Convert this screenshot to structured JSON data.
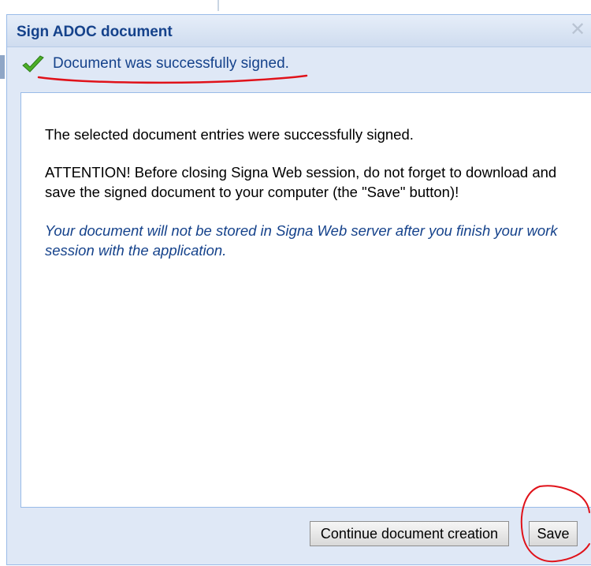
{
  "dialog": {
    "title": "Sign ADOC document",
    "close_icon": "close-icon",
    "status": {
      "icon": "green-check-icon",
      "text": "Document was successfully signed."
    },
    "message": {
      "line1": "The selected document entries were successfully signed.",
      "line2": "ATTENTION! Before closing Signa Web session, do not forget to download and save the signed document to your computer (the \"Save\" button)!",
      "line3": "Your document will not be stored in Signa Web server after you finish your work session with the application."
    },
    "buttons": {
      "continue_label": "Continue document creation",
      "save_label": "Save"
    }
  },
  "colors": {
    "title_text": "#15428b",
    "annotation_red": "#e0121a",
    "check_green": "#4caf27",
    "dialog_bg": "#dfe8f6",
    "border": "#99bbe8"
  }
}
